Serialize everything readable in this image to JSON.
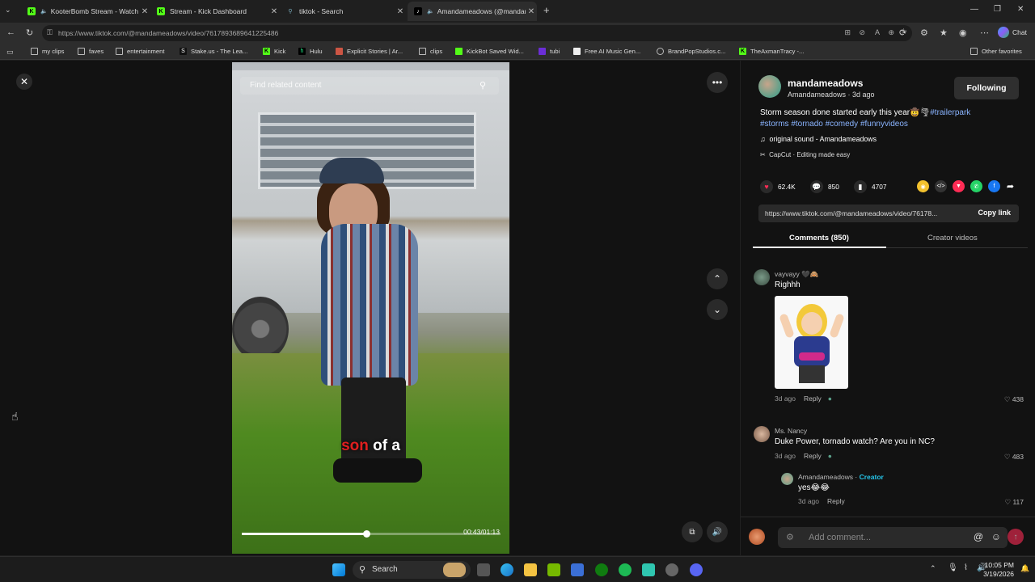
{
  "browser": {
    "tabs": [
      {
        "title": "KooterBomb Stream - Watch",
        "active": false
      },
      {
        "title": "Stream - Kick Dashboard",
        "active": false
      },
      {
        "title": "tiktok - Search",
        "active": false
      },
      {
        "title": "Amandameadows (@mandam",
        "active": true
      }
    ],
    "url": "https://www.tiktok.com/@mandameadows/video/7617893689641225486",
    "bookmarks": [
      "my clips",
      "faves",
      "entertainment",
      "Stake.us - The Lea...",
      "Kick",
      "Hulu",
      "Explicit Stories | Ar...",
      "clips",
      "KickBot Saved Wid...",
      "tubi",
      "Free AI Music Gen...",
      "BrandPopStudios.c...",
      "TheAxmanTracy -..."
    ],
    "other_favorites": "Other favorites",
    "chat_label": "Chat"
  },
  "video": {
    "search_placeholder": "Find related content",
    "caption_red": "son",
    "caption_rest": " of a",
    "timecode": "00:43/01:13",
    "progress_fraction": 0.48
  },
  "post": {
    "username": "mandameadows",
    "subline": "Amandameadows · 3d ago",
    "follow_label": "Following",
    "desc_text": "Storm season done started early this year🤠🌪",
    "hashtags": [
      "#trailerpark",
      "#storms",
      "#tornado",
      "#comedy",
      "#funnyvideos"
    ],
    "sound": "original sound - Amandameadows",
    "capcut": "CapCut · Editing made easy",
    "likes": "62.4K",
    "comments": "850",
    "saves": "4707",
    "link": "https://www.tiktok.com/@mandameadows/video/76178...",
    "copy_label": "Copy link",
    "tab_comments": "Comments (850)",
    "tab_creator": "Creator videos"
  },
  "comments": [
    {
      "name": "vayvayy 🖤🙈",
      "text": "Righhh",
      "meta": "3d ago",
      "reply": "Reply",
      "likes": "438"
    },
    {
      "name": "Ms. Nancy",
      "text": "Duke Power, tornado watch? Are you in NC?",
      "meta": "3d ago",
      "reply": "Reply",
      "likes": "483"
    },
    {
      "name": "Amandameadows",
      "creator": "Creator",
      "text": "yes😂😂",
      "meta": "3d ago",
      "reply": "Reply",
      "likes": "117"
    }
  ],
  "comment_input": {
    "placeholder": "Add comment..."
  },
  "taskbar": {
    "search": "Search",
    "time": "10:05 PM",
    "date": "3/19/2026"
  },
  "colors": {
    "tiktok_red": "#fe2c55",
    "hashtag_blue": "#8ab4ff",
    "kick_green": "#53fc18"
  }
}
